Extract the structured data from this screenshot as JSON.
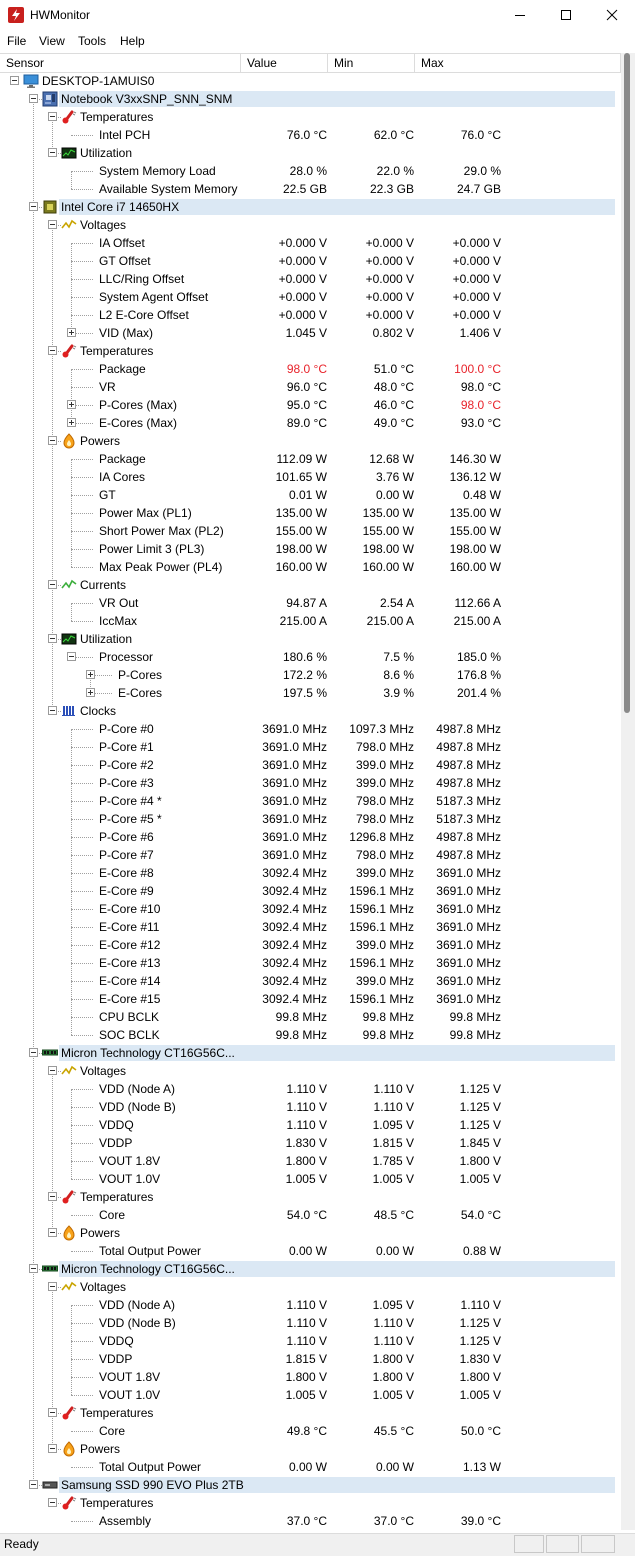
{
  "window": {
    "title": "HWMonitor"
  },
  "menu": [
    "File",
    "View",
    "Tools",
    "Help"
  ],
  "columns": {
    "sensor": "Sensor",
    "value": "Value",
    "min": "Min",
    "max": "Max"
  },
  "status": "Ready",
  "colors": {
    "highlight": "#dbe8f4",
    "warning": "#e8232b"
  },
  "rows": [
    {
      "level": 0,
      "type": "computer",
      "label": "DESKTOP-1AMUIS0",
      "toggle": "minus"
    },
    {
      "level": 1,
      "type": "device",
      "icon": "motherboard-icon",
      "label": "Notebook V3xxSNP_SNN_SNM",
      "toggle": "minus"
    },
    {
      "level": 2,
      "type": "group",
      "icon": "thermometer-icon",
      "label": "Temperatures",
      "toggle": "minus"
    },
    {
      "level": 3,
      "type": "sensor",
      "label": "Intel PCH",
      "value": "76.0 °C",
      "min": "62.0 °C",
      "max": "76.0 °C"
    },
    {
      "level": 2,
      "type": "group",
      "icon": "utilization-icon",
      "label": "Utilization",
      "toggle": "minus"
    },
    {
      "level": 3,
      "type": "sensor",
      "label": "System Memory Load",
      "value": "28.0 %",
      "min": "22.0 %",
      "max": "29.0 %"
    },
    {
      "level": 3,
      "type": "sensor",
      "label": "Available System Memory",
      "value": "22.5 GB",
      "min": "22.3 GB",
      "max": "24.7 GB"
    },
    {
      "level": 1,
      "type": "device",
      "icon": "cpu-icon",
      "label": "Intel Core i7 14650HX",
      "toggle": "minus"
    },
    {
      "level": 2,
      "type": "group",
      "icon": "voltage-icon",
      "label": "Voltages",
      "toggle": "minus"
    },
    {
      "level": 3,
      "type": "sensor",
      "label": "IA Offset",
      "value": "+0.000 V",
      "min": "+0.000 V",
      "max": "+0.000 V"
    },
    {
      "level": 3,
      "type": "sensor",
      "label": "GT Offset",
      "value": "+0.000 V",
      "min": "+0.000 V",
      "max": "+0.000 V"
    },
    {
      "level": 3,
      "type": "sensor",
      "label": "LLC/Ring Offset",
      "value": "+0.000 V",
      "min": "+0.000 V",
      "max": "+0.000 V"
    },
    {
      "level": 3,
      "type": "sensor",
      "label": "System Agent Offset",
      "value": "+0.000 V",
      "min": "+0.000 V",
      "max": "+0.000 V"
    },
    {
      "level": 3,
      "type": "sensor",
      "label": "L2 E-Core Offset",
      "value": "+0.000 V",
      "min": "+0.000 V",
      "max": "+0.000 V"
    },
    {
      "level": 3,
      "type": "sensor",
      "label": "VID (Max)",
      "toggle": "plus",
      "value": "1.045 V",
      "min": "0.802 V",
      "max": "1.406 V"
    },
    {
      "level": 2,
      "type": "group",
      "icon": "thermometer-icon",
      "label": "Temperatures",
      "toggle": "minus"
    },
    {
      "level": 3,
      "type": "sensor",
      "label": "Package",
      "value": "98.0 °C",
      "min": "51.0 °C",
      "max": "100.0 °C",
      "value_alert": true,
      "max_alert": true
    },
    {
      "level": 3,
      "type": "sensor",
      "label": "VR",
      "value": "96.0 °C",
      "min": "48.0 °C",
      "max": "98.0 °C"
    },
    {
      "level": 3,
      "type": "sensor",
      "label": "P-Cores (Max)",
      "toggle": "plus",
      "value": "95.0 °C",
      "min": "46.0 °C",
      "max": "98.0 °C",
      "max_alert": true
    },
    {
      "level": 3,
      "type": "sensor",
      "label": "E-Cores (Max)",
      "toggle": "plus",
      "value": "89.0 °C",
      "min": "49.0 °C",
      "max": "93.0 °C"
    },
    {
      "level": 2,
      "type": "group",
      "icon": "power-icon",
      "label": "Powers",
      "toggle": "minus"
    },
    {
      "level": 3,
      "type": "sensor",
      "label": "Package",
      "value": "112.09 W",
      "min": "12.68 W",
      "max": "146.30 W"
    },
    {
      "level": 3,
      "type": "sensor",
      "label": "IA Cores",
      "value": "101.65 W",
      "min": "3.76 W",
      "max": "136.12 W"
    },
    {
      "level": 3,
      "type": "sensor",
      "label": "GT",
      "value": "0.01 W",
      "min": "0.00 W",
      "max": "0.48 W"
    },
    {
      "level": 3,
      "type": "sensor",
      "label": "Power Max (PL1)",
      "value": "135.00 W",
      "min": "135.00 W",
      "max": "135.00 W"
    },
    {
      "level": 3,
      "type": "sensor",
      "label": "Short Power Max (PL2)",
      "value": "155.00 W",
      "min": "155.00 W",
      "max": "155.00 W"
    },
    {
      "level": 3,
      "type": "sensor",
      "label": "Power Limit 3 (PL3)",
      "value": "198.00 W",
      "min": "198.00 W",
      "max": "198.00 W"
    },
    {
      "level": 3,
      "type": "sensor",
      "label": "Max Peak Power (PL4)",
      "value": "160.00 W",
      "min": "160.00 W",
      "max": "160.00 W"
    },
    {
      "level": 2,
      "type": "group",
      "icon": "current-icon",
      "label": "Currents",
      "toggle": "minus"
    },
    {
      "level": 3,
      "type": "sensor",
      "label": "VR Out",
      "value": "94.87 A",
      "min": "2.54 A",
      "max": "112.66 A"
    },
    {
      "level": 3,
      "type": "sensor",
      "label": "IccMax",
      "value": "215.00 A",
      "min": "215.00 A",
      "max": "215.00 A"
    },
    {
      "level": 2,
      "type": "group",
      "icon": "utilization-icon",
      "label": "Utilization",
      "toggle": "minus"
    },
    {
      "level": 3,
      "type": "sensor",
      "label": "Processor",
      "toggle": "minus",
      "value": "180.6 %",
      "min": "7.5 %",
      "max": "185.0 %"
    },
    {
      "level": 4,
      "type": "sensor",
      "label": "P-Cores",
      "toggle": "plus",
      "value": "172.2 %",
      "min": "8.6 %",
      "max": "176.8 %"
    },
    {
      "level": 4,
      "type": "sensor",
      "label": "E-Cores",
      "toggle": "plus",
      "value": "197.5 %",
      "min": "3.9 %",
      "max": "201.4 %"
    },
    {
      "level": 2,
      "type": "group",
      "icon": "clock-icon",
      "label": "Clocks",
      "toggle": "minus"
    },
    {
      "level": 3,
      "type": "sensor",
      "label": "P-Core #0",
      "value": "3691.0 MHz",
      "min": "1097.3 MHz",
      "max": "4987.8 MHz"
    },
    {
      "level": 3,
      "type": "sensor",
      "label": "P-Core #1",
      "value": "3691.0 MHz",
      "min": "798.0 MHz",
      "max": "4987.8 MHz"
    },
    {
      "level": 3,
      "type": "sensor",
      "label": "P-Core #2",
      "value": "3691.0 MHz",
      "min": "399.0 MHz",
      "max": "4987.8 MHz"
    },
    {
      "level": 3,
      "type": "sensor",
      "label": "P-Core #3",
      "value": "3691.0 MHz",
      "min": "399.0 MHz",
      "max": "4987.8 MHz"
    },
    {
      "level": 3,
      "type": "sensor",
      "label": "P-Core #4 *",
      "value": "3691.0 MHz",
      "min": "798.0 MHz",
      "max": "5187.3 MHz"
    },
    {
      "level": 3,
      "type": "sensor",
      "label": "P-Core #5 *",
      "value": "3691.0 MHz",
      "min": "798.0 MHz",
      "max": "5187.3 MHz"
    },
    {
      "level": 3,
      "type": "sensor",
      "label": "P-Core #6",
      "value": "3691.0 MHz",
      "min": "1296.8 MHz",
      "max": "4987.8 MHz"
    },
    {
      "level": 3,
      "type": "sensor",
      "label": "P-Core #7",
      "value": "3691.0 MHz",
      "min": "798.0 MHz",
      "max": "4987.8 MHz"
    },
    {
      "level": 3,
      "type": "sensor",
      "label": "E-Core #8",
      "value": "3092.4 MHz",
      "min": "399.0 MHz",
      "max": "3691.0 MHz"
    },
    {
      "level": 3,
      "type": "sensor",
      "label": "E-Core #9",
      "value": "3092.4 MHz",
      "min": "1596.1 MHz",
      "max": "3691.0 MHz"
    },
    {
      "level": 3,
      "type": "sensor",
      "label": "E-Core #10",
      "value": "3092.4 MHz",
      "min": "1596.1 MHz",
      "max": "3691.0 MHz"
    },
    {
      "level": 3,
      "type": "sensor",
      "label": "E-Core #11",
      "value": "3092.4 MHz",
      "min": "1596.1 MHz",
      "max": "3691.0 MHz"
    },
    {
      "level": 3,
      "type": "sensor",
      "label": "E-Core #12",
      "value": "3092.4 MHz",
      "min": "399.0 MHz",
      "max": "3691.0 MHz"
    },
    {
      "level": 3,
      "type": "sensor",
      "label": "E-Core #13",
      "value": "3092.4 MHz",
      "min": "1596.1 MHz",
      "max": "3691.0 MHz"
    },
    {
      "level": 3,
      "type": "sensor",
      "label": "E-Core #14",
      "value": "3092.4 MHz",
      "min": "399.0 MHz",
      "max": "3691.0 MHz"
    },
    {
      "level": 3,
      "type": "sensor",
      "label": "E-Core #15",
      "value": "3092.4 MHz",
      "min": "1596.1 MHz",
      "max": "3691.0 MHz"
    },
    {
      "level": 3,
      "type": "sensor",
      "label": "CPU BCLK",
      "value": "99.8 MHz",
      "min": "99.8 MHz",
      "max": "99.8 MHz"
    },
    {
      "level": 3,
      "type": "sensor",
      "label": "SOC BCLK",
      "value": "99.8 MHz",
      "min": "99.8 MHz",
      "max": "99.8 MHz"
    },
    {
      "level": 1,
      "type": "device",
      "icon": "memory-icon",
      "label": "Micron Technology CT16G56C...",
      "toggle": "minus"
    },
    {
      "level": 2,
      "type": "group",
      "icon": "voltage-icon",
      "label": "Voltages",
      "toggle": "minus"
    },
    {
      "level": 3,
      "type": "sensor",
      "label": "VDD (Node A)",
      "value": "1.110 V",
      "min": "1.110 V",
      "max": "1.125 V"
    },
    {
      "level": 3,
      "type": "sensor",
      "label": "VDD (Node B)",
      "value": "1.110 V",
      "min": "1.110 V",
      "max": "1.125 V"
    },
    {
      "level": 3,
      "type": "sensor",
      "label": "VDDQ",
      "value": "1.110 V",
      "min": "1.095 V",
      "max": "1.125 V"
    },
    {
      "level": 3,
      "type": "sensor",
      "label": "VDDP",
      "value": "1.830 V",
      "min": "1.815 V",
      "max": "1.845 V"
    },
    {
      "level": 3,
      "type": "sensor",
      "label": "VOUT 1.8V",
      "value": "1.800 V",
      "min": "1.785 V",
      "max": "1.800 V"
    },
    {
      "level": 3,
      "type": "sensor",
      "label": "VOUT 1.0V",
      "value": "1.005 V",
      "min": "1.005 V",
      "max": "1.005 V"
    },
    {
      "level": 2,
      "type": "group",
      "icon": "thermometer-icon",
      "label": "Temperatures",
      "toggle": "minus"
    },
    {
      "level": 3,
      "type": "sensor",
      "label": "Core",
      "value": "54.0 °C",
      "min": "48.5 °C",
      "max": "54.0 °C"
    },
    {
      "level": 2,
      "type": "group",
      "icon": "power-icon",
      "label": "Powers",
      "toggle": "minus"
    },
    {
      "level": 3,
      "type": "sensor",
      "label": "Total Output Power",
      "value": "0.00 W",
      "min": "0.00 W",
      "max": "0.88 W"
    },
    {
      "level": 1,
      "type": "device",
      "icon": "memory-icon",
      "label": "Micron Technology CT16G56C...",
      "toggle": "minus"
    },
    {
      "level": 2,
      "type": "group",
      "icon": "voltage-icon",
      "label": "Voltages",
      "toggle": "minus"
    },
    {
      "level": 3,
      "type": "sensor",
      "label": "VDD (Node A)",
      "value": "1.110 V",
      "min": "1.095 V",
      "max": "1.110 V"
    },
    {
      "level": 3,
      "type": "sensor",
      "label": "VDD (Node B)",
      "value": "1.110 V",
      "min": "1.110 V",
      "max": "1.125 V"
    },
    {
      "level": 3,
      "type": "sensor",
      "label": "VDDQ",
      "value": "1.110 V",
      "min": "1.110 V",
      "max": "1.125 V"
    },
    {
      "level": 3,
      "type": "sensor",
      "label": "VDDP",
      "value": "1.815 V",
      "min": "1.800 V",
      "max": "1.830 V"
    },
    {
      "level": 3,
      "type": "sensor",
      "label": "VOUT 1.8V",
      "value": "1.800 V",
      "min": "1.800 V",
      "max": "1.800 V"
    },
    {
      "level": 3,
      "type": "sensor",
      "label": "VOUT 1.0V",
      "value": "1.005 V",
      "min": "1.005 V",
      "max": "1.005 V"
    },
    {
      "level": 2,
      "type": "group",
      "icon": "thermometer-icon",
      "label": "Temperatures",
      "toggle": "minus"
    },
    {
      "level": 3,
      "type": "sensor",
      "label": "Core",
      "value": "49.8 °C",
      "min": "45.5 °C",
      "max": "50.0 °C"
    },
    {
      "level": 2,
      "type": "group",
      "icon": "power-icon",
      "label": "Powers",
      "toggle": "minus"
    },
    {
      "level": 3,
      "type": "sensor",
      "label": "Total Output Power",
      "value": "0.00 W",
      "min": "0.00 W",
      "max": "1.13 W"
    },
    {
      "level": 1,
      "type": "device",
      "icon": "ssd-icon",
      "label": "Samsung SSD 990 EVO Plus 2TB",
      "toggle": "minus"
    },
    {
      "level": 2,
      "type": "group",
      "icon": "thermometer-icon",
      "label": "Temperatures",
      "toggle": "minus"
    },
    {
      "level": 3,
      "type": "sensor",
      "label": "Assembly",
      "value": "37.0 °C",
      "min": "37.0 °C",
      "max": "39.0 °C"
    }
  ]
}
